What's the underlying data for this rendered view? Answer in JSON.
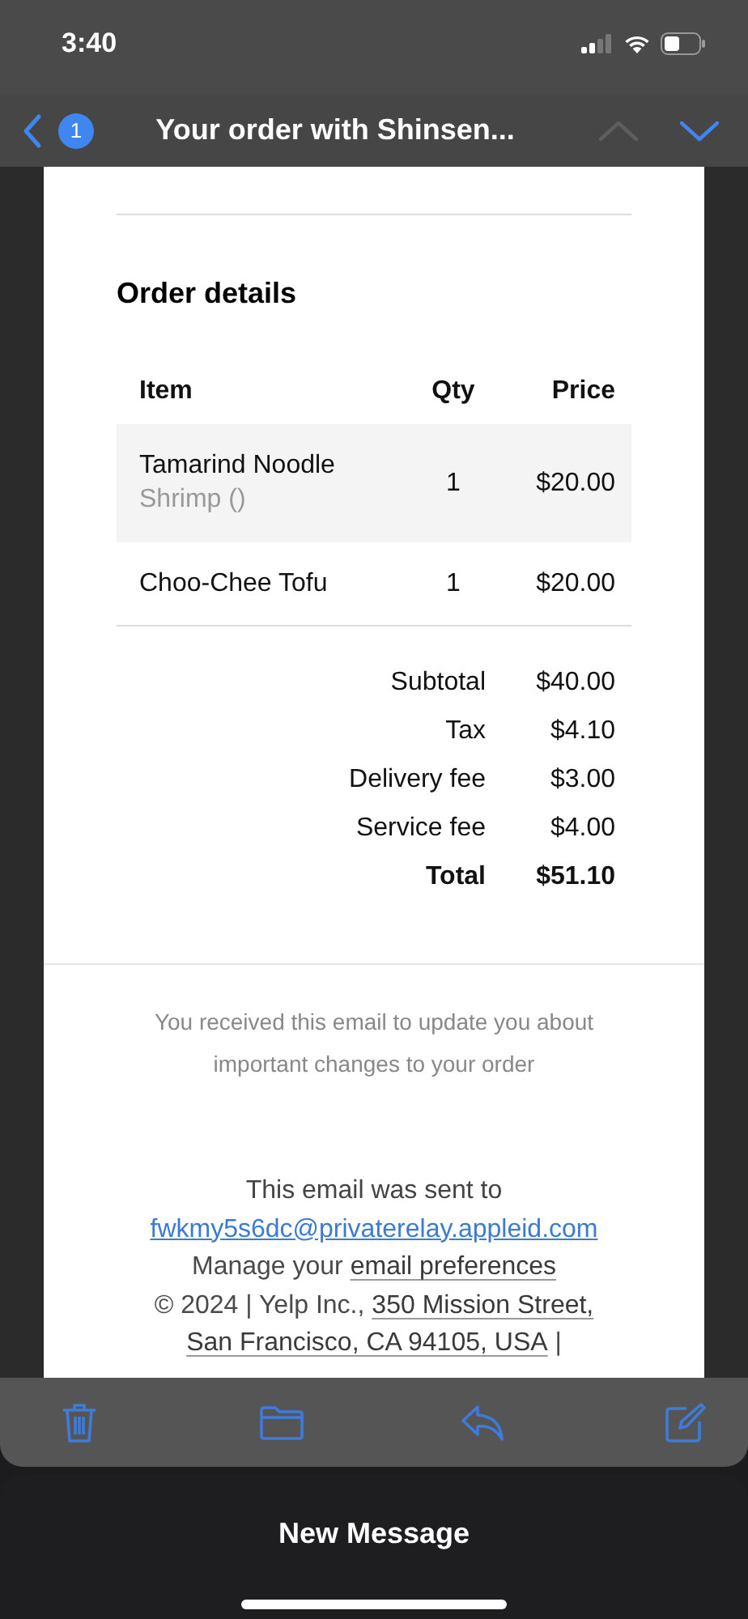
{
  "status_bar": {
    "time": "3:40"
  },
  "nav": {
    "unread_count": "1",
    "title": "Your order with Shinsen...",
    "up_enabled": false,
    "down_enabled": true
  },
  "order": {
    "heading": "Order details",
    "columns": [
      "Item",
      "Qty",
      "Price"
    ],
    "rows": [
      {
        "name": "Tamarind Noodle",
        "option": "Shrimp ()",
        "qty": "1",
        "price": "$20.00",
        "shaded": true
      },
      {
        "name": "Choo-Chee Tofu",
        "qty": "1",
        "price": "$20.00",
        "shaded": false
      }
    ],
    "summary": [
      {
        "label": "Subtotal",
        "value": "$40.00",
        "bold": false
      },
      {
        "label": "Tax",
        "value": "$4.10",
        "bold": false
      },
      {
        "label": "Delivery fee",
        "value": "$3.00",
        "bold": false
      },
      {
        "label": "Service fee",
        "value": "$4.00",
        "bold": false
      },
      {
        "label": "Total",
        "value": "$51.10",
        "bold": true
      }
    ]
  },
  "notice": "You received this email to update you about important changes to your order",
  "footer": {
    "sent_to": "This email was sent to",
    "email": "fwkmy5s6dc@privaterelay.appleid.com",
    "manage": [
      {
        "text": "Manage your ",
        "link": false
      },
      {
        "text": "email preferences",
        "link": true
      }
    ],
    "address": [
      {
        "text": "© 2024 | Yelp Inc.,",
        "link": false
      },
      {
        "text": "350 Mission Street,",
        "link": true
      },
      {
        "text": "San Francisco, CA 94105, USA",
        "link": true
      },
      {
        "text": "|",
        "link": false
      }
    ]
  },
  "toolbar": [
    {
      "kind": "trash"
    },
    {
      "kind": "folder"
    },
    {
      "kind": "reply"
    },
    {
      "kind": "compose"
    }
  ],
  "draft_bar": {
    "title": "New Message"
  }
}
